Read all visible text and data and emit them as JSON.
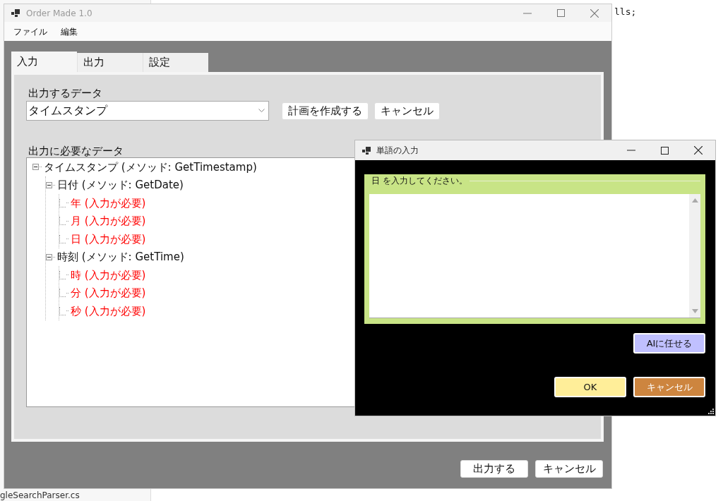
{
  "background_editor": {
    "code_fragment": "lls;",
    "file_name": "gleSearchParser.cs"
  },
  "window": {
    "title": "Order Made 1.0"
  },
  "menu": [
    "ファイル",
    "編集"
  ],
  "tabs": [
    {
      "label": "入力",
      "selected": true
    },
    {
      "label": "出力",
      "selected": false
    },
    {
      "label": "設定",
      "selected": false
    }
  ],
  "output_data": {
    "label": "出力するデータ",
    "dropdown_value": "タイムスタンプ",
    "buttons": [
      "計画を作成する",
      "キャンセル"
    ]
  },
  "required_data": {
    "label": "出力に必要なデータ",
    "tree": [
      {
        "label": "タイムスタンプ (メソッド: GetTimestamp)",
        "required": false,
        "expanded": true,
        "children": [
          {
            "label": "日付 (メソッド: GetDate)",
            "required": false,
            "expanded": true,
            "children": [
              {
                "label": "年 (入力が必要)",
                "required": true
              },
              {
                "label": "月 (入力が必要)",
                "required": true
              },
              {
                "label": "日 (入力が必要)",
                "required": true
              }
            ]
          },
          {
            "label": "時刻 (メソッド: GetTime)",
            "required": false,
            "expanded": true,
            "children": [
              {
                "label": "時 (入力が必要)",
                "required": true
              },
              {
                "label": "分 (入力が必要)",
                "required": true
              },
              {
                "label": "秒 (入力が必要)",
                "required": true
              }
            ]
          }
        ]
      }
    ]
  },
  "footer_buttons": [
    "出力する",
    "キャンセル"
  ],
  "dialog": {
    "title": "単語の入力",
    "group_label": "日 を入力してください。",
    "buttons": [
      {
        "label": "AIに任せる",
        "kind": "assist",
        "color": "#c0c0ff"
      },
      {
        "label": "OK",
        "kind": "confirm",
        "color": "#ffee99"
      },
      {
        "label": "キャンセル",
        "kind": "cancel",
        "color": "#cd853f"
      }
    ]
  }
}
